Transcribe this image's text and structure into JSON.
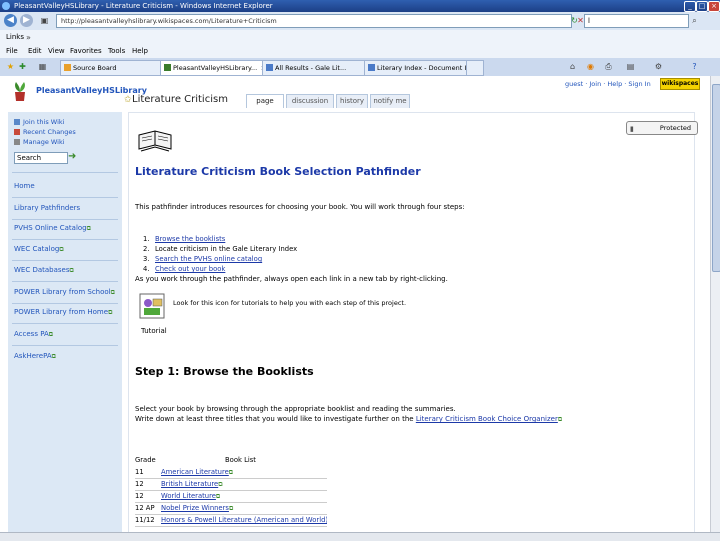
{
  "window": {
    "title": "PleasantValleyHSLibrary - Literature Criticism - Windows Internet Explorer",
    "controls": [
      "_",
      "□",
      "×"
    ]
  },
  "address_bar": {
    "url": "http://pleasantvalleyhslibrary.wikispaces.com/Literature+Criticism",
    "search_value": "l"
  },
  "links_bar": {
    "label": "Links"
  },
  "menu": {
    "items": [
      "File",
      "Edit",
      "View",
      "Favorites",
      "Tools",
      "Help"
    ]
  },
  "browser_tabs": [
    {
      "label": "Source Board"
    },
    {
      "label": "PleasantValleyHSLibrary..."
    },
    {
      "label": "All Results - Gale Lit..."
    },
    {
      "label": "Literary Index - Document ID..."
    }
  ],
  "wiki": {
    "site_name": "PleasantValleyHSLibrary",
    "page_name": "Literature Criticism",
    "page_tabs": [
      "page",
      "discussion",
      "history",
      "notify me"
    ],
    "user_links": "guest · Join · Help · Sign In",
    "brand": "wikispaces",
    "protected_label": "Protected"
  },
  "sidebar": {
    "top_links": [
      "Join this Wiki",
      "Recent Changes",
      "Manage Wiki"
    ],
    "search_value": "Search",
    "nav": [
      {
        "label": "Home",
        "ext": false
      },
      {
        "label": "Library Pathfinders",
        "ext": false
      },
      {
        "label": "PVHS Online Catalog",
        "ext": true
      },
      {
        "label": "WEC Catalog",
        "ext": true
      },
      {
        "label": "WEC Databases",
        "ext": true
      },
      {
        "label": "POWER Library from School",
        "ext": true
      },
      {
        "label": "POWER Library from Home",
        "ext": true
      },
      {
        "label": "Access PA",
        "ext": true
      },
      {
        "label": "AskHerePA",
        "ext": true
      }
    ]
  },
  "content": {
    "heading": "Literature Criticism Book Selection Pathfinder",
    "intro": "This pathfinder introduces resources for choosing your book. You will work through four steps:",
    "steps": [
      {
        "num": "1.",
        "text": "Browse the booklists",
        "link": true
      },
      {
        "num": "2.",
        "text": "Locate criticism in the Gale Literary Index",
        "link": false
      },
      {
        "num": "3.",
        "text": "Search the PVHS online catalog",
        "link": true
      },
      {
        "num": "4.",
        "text": "Check out your book",
        "link": true
      }
    ],
    "tip": "As you work through the pathfinder, always open each link in a new tab by right-clicking.",
    "tutorial_desc": "Look for this icon for tutorials to help you with each step of this project.",
    "tutorial_label": "Tutorial",
    "step1_heading": "Step 1: Browse the Booklists",
    "step1_line1": "Select your book by browsing through the appropriate booklist and reading the summaries.",
    "step1_line2_prefix": "Write down at least three titles that you would like to investigate further on the ",
    "step1_line2_link": "Literary Criticism Book Choice Organizer",
    "table": {
      "headers": [
        "Grade",
        "Book List"
      ],
      "rows": [
        {
          "grade": "11",
          "list": "American Literature"
        },
        {
          "grade": "12",
          "list": "British Literature"
        },
        {
          "grade": "12",
          "list": "World Literature"
        },
        {
          "grade": "12 AP",
          "list": "Nobel Prize Winners"
        },
        {
          "grade": "11/12",
          "list": "Honors & Powell Literature (American and World)"
        }
      ]
    }
  }
}
